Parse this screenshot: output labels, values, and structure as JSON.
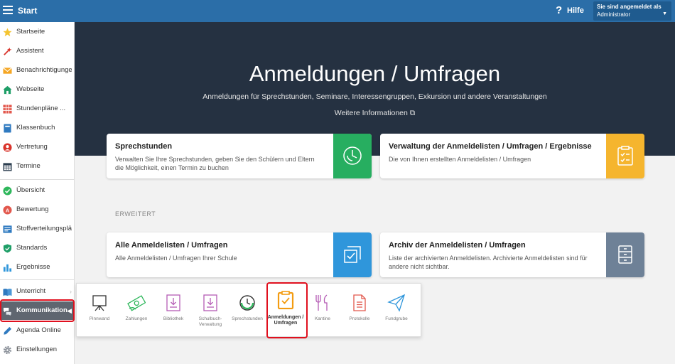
{
  "topbar": {
    "title": "Start",
    "help_symbol": "?",
    "help_label": "Hilfe",
    "user_line1": "Sie sind angemeldet als",
    "user_line2": "Administrator",
    "user_caret": "▼"
  },
  "sidebar": {
    "items": [
      {
        "label": "Startseite",
        "icon": "star-icon"
      },
      {
        "label": "Assistent",
        "icon": "wand-icon"
      },
      {
        "label": "Benachrichtigungen",
        "icon": "envelope-icon"
      },
      {
        "label": "Webseite",
        "icon": "house-icon"
      },
      {
        "label": "Stundenpläne ...",
        "icon": "timetable-icon"
      },
      {
        "label": "Klassenbuch",
        "icon": "classbook-icon"
      },
      {
        "label": "Vertretung",
        "icon": "substitution-icon"
      },
      {
        "label": "Termine",
        "icon": "calendar-icon"
      },
      {
        "label": "Übersicht",
        "icon": "check-circle-icon"
      },
      {
        "label": "Bewertung",
        "icon": "grade-icon"
      },
      {
        "label": "Stoffverteilungspläne",
        "icon": "curriculum-icon"
      },
      {
        "label": "Standards",
        "icon": "shield-icon"
      },
      {
        "label": "Ergebnisse",
        "icon": "bar-chart-icon"
      },
      {
        "label": "Unterricht",
        "icon": "book-icon"
      },
      {
        "label": "Kommunikation",
        "icon": "chat-icon"
      },
      {
        "label": "Agenda Online",
        "icon": "pen-icon"
      },
      {
        "label": "Einstellungen",
        "icon": "gear-icon"
      }
    ],
    "chevron": "›",
    "active_chevron": "◀"
  },
  "hero": {
    "title": "Anmeldungen / Umfragen",
    "subtitle": "Anmeldungen für Sprechstunden, Seminare, Interessengruppen, Exkursion und andere Veranstaltungen",
    "link": "Weitere Informationen",
    "link_icon": "⧉"
  },
  "cards": [
    {
      "title": "Sprechstunden",
      "desc": "Verwalten Sie Ihre Sprechstunden, geben Sie den Schülern und Eltern die Möglichkeit, einen Termin zu buchen",
      "color": "#27ae60",
      "icon": "clock-icon"
    },
    {
      "title": "Verwaltung der Anmeldelisten / Umfragen / Ergebnisse",
      "desc": "Die von Ihnen erstellten Anmeldelisten / Umfragen",
      "color": "#f5b52e",
      "icon": "clipboard-check-icon"
    },
    {
      "title": "Alle Anmeldelisten / Umfragen",
      "desc": "Alle Anmeldelisten / Umfragen Ihrer Schule",
      "color": "#2f96db",
      "icon": "checkbox-stack-icon"
    },
    {
      "title": "Archiv der Anmeldelisten / Umfragen",
      "desc": "Liste der archivierten Anmeldelisten. Archivierte Anmeldelisten sind für andere nicht sichtbar.",
      "color": "#6e8197",
      "icon": "cabinet-icon"
    }
  ],
  "section_label": "ERWEITERT",
  "popup": {
    "items": [
      {
        "label": "Pinnwand",
        "icon": "easel-icon"
      },
      {
        "label": "Zahlungen",
        "icon": "money-icon"
      },
      {
        "label": "Bibliothek",
        "icon": "library-icon"
      },
      {
        "label": "Schulbuch-Verwaltung",
        "icon": "schoolbook-icon"
      },
      {
        "label": "Sprechstunden",
        "icon": "clock-icon"
      },
      {
        "label": "Anmeldungen / Umfragen",
        "icon": "clipboard-check-icon"
      },
      {
        "label": "Kantine",
        "icon": "cutlery-icon"
      },
      {
        "label": "Protokolle",
        "icon": "document-icon"
      },
      {
        "label": "Fundgrube",
        "icon": "paper-plane-icon"
      }
    ]
  }
}
